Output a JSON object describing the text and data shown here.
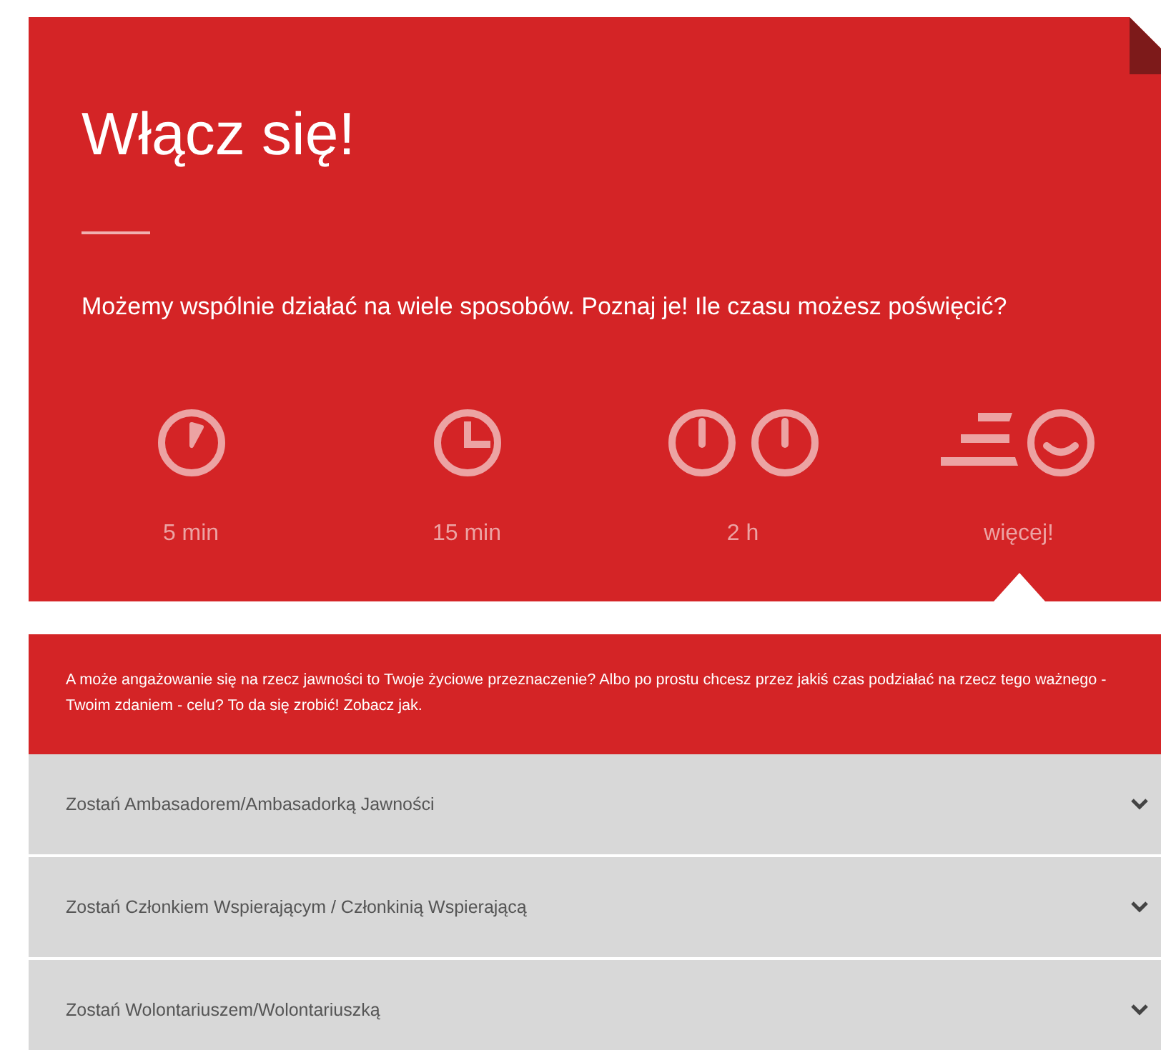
{
  "hero": {
    "title": "Włącz się!",
    "subtitle": "Możemy wspólnie działać na wiele sposobów. Poznaj je! Ile czasu możesz poświęcić?"
  },
  "options": [
    {
      "kind": "five",
      "label": "5 min",
      "selected": false
    },
    {
      "kind": "fifteen",
      "label": "15 min",
      "selected": false
    },
    {
      "kind": "hours",
      "label": "2 h",
      "selected": false
    },
    {
      "kind": "more",
      "label": "więcej!",
      "selected": true
    }
  ],
  "info": {
    "text": "A może angażowanie się na rzecz jawności to Twoje życiowe przeznaczenie? Albo po prostu chcesz przez jakiś czas podziałać na rzecz tego ważnego - Twoim zdaniem - celu? To da się zrobić! Zobacz jak."
  },
  "accordion": [
    {
      "label": "Zostań Ambasadorem/Ambasadorką Jawności",
      "expanded": false
    },
    {
      "label": "Zostań Członkiem Wspierającym / Członkinią Wspierającą",
      "expanded": false
    },
    {
      "label": "Zostań Wolontariuszem/Wolontariuszką",
      "expanded": false
    }
  ]
}
